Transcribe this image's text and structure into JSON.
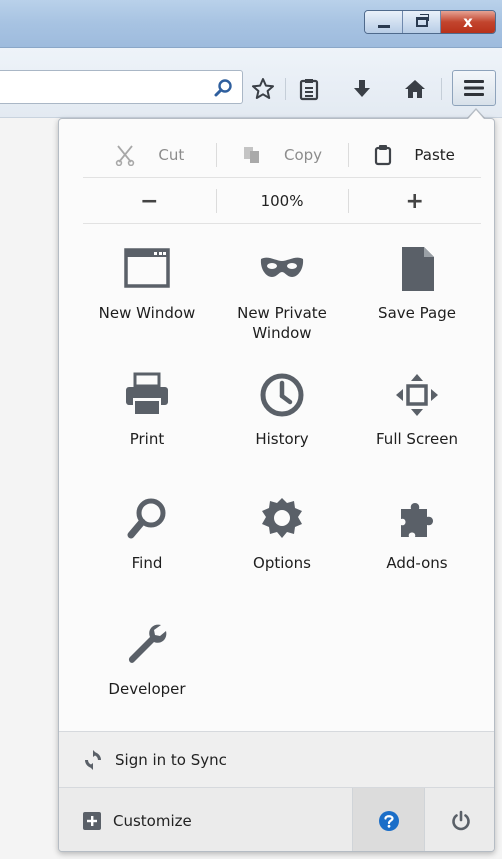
{
  "window": {
    "close_label": "x"
  },
  "toolbar": {
    "url_value": "",
    "icons": [
      "search-icon",
      "bookmark-star-icon",
      "reading-list-icon",
      "download-icon",
      "home-icon",
      "hamburger-menu-icon"
    ]
  },
  "menu": {
    "edit": {
      "cut": "Cut",
      "copy": "Copy",
      "paste": "Paste"
    },
    "zoom": {
      "minus": "−",
      "level": "100%",
      "plus": "+"
    },
    "items": [
      {
        "label": "New Window",
        "icon": "new-window-icon"
      },
      {
        "label": "New Private Window",
        "icon": "private-mask-icon"
      },
      {
        "label": "Save Page",
        "icon": "save-page-icon"
      },
      {
        "label": "Print",
        "icon": "printer-icon"
      },
      {
        "label": "History",
        "icon": "history-clock-icon"
      },
      {
        "label": "Full Screen",
        "icon": "fullscreen-icon"
      },
      {
        "label": "Find",
        "icon": "find-magnifier-icon"
      },
      {
        "label": "Options",
        "icon": "options-gear-icon"
      },
      {
        "label": "Add-ons",
        "icon": "addons-puzzle-icon"
      },
      {
        "label": "Developer",
        "icon": "developer-wrench-icon"
      }
    ],
    "sync_label": "Sign in to Sync",
    "customize_label": "Customize"
  },
  "colors": {
    "icon_gray": "#5a6068",
    "help_blue": "#1b6ec8",
    "panel_bg": "#fbfbfb"
  }
}
